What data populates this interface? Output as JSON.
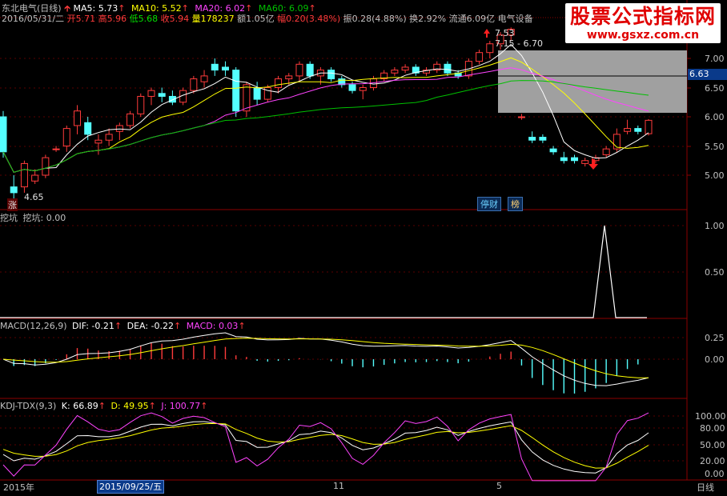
{
  "header": {
    "title": "东北电气(日线)",
    "ma5_label": "MA5: 5.73",
    "ma10_label": "MA10: 5.52",
    "ma20_label": "MA20: 6.02",
    "ma60_label": "MA60: 6.09",
    "date": "2016/05/31/二",
    "open": "开5.71",
    "high": "高5.96",
    "low": "低5.68",
    "close": "收5.94",
    "volume": "量178237",
    "amount": "额1.05亿",
    "change": "幅0.20(3.48%)",
    "amplitude": "振0.28(4.88%)",
    "turnover": "换2.92%",
    "float_cap": "流通6.09亿",
    "sector": "电气设备"
  },
  "watermark": {
    "line1": "股票公式指标网",
    "line2": "www.gsxz.com.cn"
  },
  "price_panel": {
    "y_ticks": [
      "7.00",
      "6.50",
      "6.00",
      "5.50",
      "5.00"
    ],
    "current_price": "6.63",
    "high_marker": "7.53",
    "range_label": "7.15 - 6.70",
    "low_marker": "4.65",
    "low_flag": "涨",
    "btn_financial": "停财",
    "btn_rank": "榜",
    "colors": {
      "up": "#ff3b3b",
      "down": "#54ffff",
      "ma5": "#ffffff",
      "ma10": "#ffff00",
      "ma20": "#ff44ff",
      "ma60": "#00c000"
    }
  },
  "wakeng_panel": {
    "name": "挖坑",
    "value_label": "挖坑: 0.00",
    "y_ticks": [
      "1.00",
      "0.50"
    ]
  },
  "macd_panel": {
    "name": "MACD(12,26,9)",
    "dif": "DIF: -0.21",
    "dea": "DEA: -0.22",
    "macd": "MACD: 0.03",
    "y_ticks": [
      "0.25",
      "0.00"
    ]
  },
  "kdj_panel": {
    "name": "KDJ-TDX(9,3)",
    "k": "K: 66.89",
    "d": "D: 49.95",
    "j": "J: 100.77",
    "y_ticks": [
      "100.00",
      "80.00",
      "50.00",
      "20.00",
      "0.00"
    ]
  },
  "bottom_bar": {
    "year_label": "2015年",
    "cursor_date": "2015/09/25/五",
    "month_11": "11",
    "month_5": "5",
    "period": "日线"
  },
  "chart_data": {
    "type": "candlestick",
    "candles_ohlc": [
      [
        6.0,
        6.1,
        5.3,
        5.4
      ],
      [
        4.8,
        5.0,
        4.6,
        4.7
      ],
      [
        4.8,
        5.25,
        4.7,
        5.2
      ],
      [
        4.9,
        5.1,
        4.85,
        5.0
      ],
      [
        5.0,
        5.35,
        4.95,
        5.3
      ],
      [
        5.45,
        5.5,
        5.4,
        5.45
      ],
      [
        5.5,
        5.85,
        5.4,
        5.8
      ],
      [
        5.85,
        6.2,
        5.7,
        6.1
      ],
      [
        5.9,
        6.0,
        5.6,
        5.7
      ],
      [
        5.55,
        5.7,
        5.35,
        5.6
      ],
      [
        5.6,
        5.8,
        5.5,
        5.7
      ],
      [
        5.75,
        5.9,
        5.6,
        5.85
      ],
      [
        5.85,
        6.1,
        5.8,
        6.05
      ],
      [
        6.05,
        6.4,
        6.0,
        6.35
      ],
      [
        6.35,
        6.5,
        6.2,
        6.45
      ],
      [
        6.4,
        6.5,
        6.25,
        6.35
      ],
      [
        6.35,
        6.45,
        6.2,
        6.25
      ],
      [
        6.25,
        6.5,
        6.2,
        6.45
      ],
      [
        6.45,
        6.7,
        6.4,
        6.65
      ],
      [
        6.6,
        6.8,
        6.5,
        6.7
      ],
      [
        6.9,
        7.0,
        6.7,
        6.8
      ],
      [
        6.85,
        6.95,
        6.7,
        6.8
      ],
      [
        6.8,
        6.85,
        6.0,
        6.1
      ],
      [
        6.1,
        6.6,
        6.0,
        6.55
      ],
      [
        6.5,
        6.6,
        6.2,
        6.3
      ],
      [
        6.3,
        6.55,
        6.25,
        6.5
      ],
      [
        6.5,
        6.7,
        6.4,
        6.65
      ],
      [
        6.65,
        6.75,
        6.55,
        6.7
      ],
      [
        6.7,
        6.95,
        6.6,
        6.9
      ],
      [
        6.9,
        6.95,
        6.65,
        6.7
      ],
      [
        6.7,
        6.85,
        6.55,
        6.8
      ],
      [
        6.8,
        6.85,
        6.6,
        6.65
      ],
      [
        6.65,
        6.7,
        6.5,
        6.55
      ],
      [
        6.55,
        6.6,
        6.4,
        6.45
      ],
      [
        6.45,
        6.55,
        6.3,
        6.5
      ],
      [
        6.5,
        6.7,
        6.45,
        6.65
      ],
      [
        6.65,
        6.8,
        6.6,
        6.75
      ],
      [
        6.75,
        6.85,
        6.7,
        6.8
      ],
      [
        6.8,
        6.9,
        6.75,
        6.85
      ],
      [
        6.85,
        6.9,
        6.7,
        6.75
      ],
      [
        6.75,
        6.85,
        6.7,
        6.8
      ],
      [
        6.8,
        6.95,
        6.75,
        6.9
      ],
      [
        6.9,
        6.95,
        6.7,
        6.75
      ],
      [
        6.75,
        6.8,
        6.65,
        6.7
      ],
      [
        6.7,
        7.0,
        6.65,
        6.95
      ],
      [
        6.95,
        7.15,
        6.9,
        7.1
      ],
      [
        7.1,
        7.3,
        7.0,
        7.25
      ],
      [
        7.25,
        7.45,
        7.15,
        7.4
      ],
      [
        7.4,
        7.53,
        7.3,
        7.5
      ],
      [
        6.0,
        6.05,
        5.95,
        6.0
      ],
      [
        5.65,
        5.75,
        5.55,
        5.6
      ],
      [
        5.65,
        5.7,
        5.55,
        5.6
      ],
      [
        5.45,
        5.5,
        5.35,
        5.4
      ],
      [
        5.3,
        5.4,
        5.2,
        5.25
      ],
      [
        5.3,
        5.35,
        5.2,
        5.25
      ],
      [
        5.2,
        5.3,
        5.15,
        5.25
      ],
      [
        5.25,
        5.35,
        5.2,
        5.3
      ],
      [
        5.35,
        5.5,
        5.3,
        5.45
      ],
      [
        5.45,
        5.8,
        5.4,
        5.7
      ],
      [
        5.75,
        5.95,
        5.7,
        5.8
      ],
      [
        5.8,
        5.85,
        5.7,
        5.75
      ],
      [
        5.71,
        5.96,
        5.68,
        5.94
      ]
    ],
    "wakeng_signal": {
      "position": 0.88,
      "value": 1.0
    },
    "kdj_note": "K, D, J oscillators 0-100"
  }
}
